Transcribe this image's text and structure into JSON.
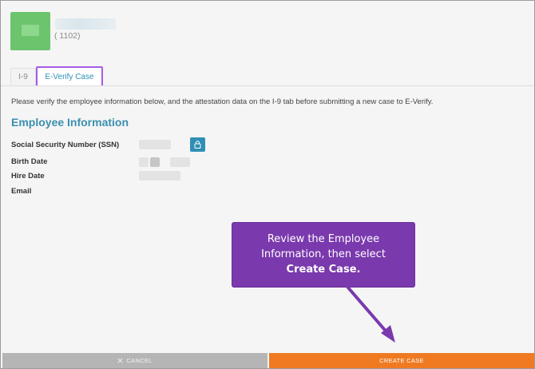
{
  "header": {
    "employee_id": "( 1102)"
  },
  "tabs": [
    {
      "label": "I-9",
      "active": false
    },
    {
      "label": "E-Verify Case",
      "active": true
    }
  ],
  "main": {
    "instructions": "Please verify the employee information below, and the attestation data on the I-9 tab before submitting a new case to E-Verify.",
    "section_title": "Employee Information",
    "fields": [
      {
        "label": "Social Security Number (SSN)"
      },
      {
        "label": "Birth Date"
      },
      {
        "label": "Hire Date"
      },
      {
        "label": "Email"
      }
    ]
  },
  "callout": {
    "line1": "Review the Employee",
    "line2": "Information, then select",
    "line3": "Create Case."
  },
  "footer": {
    "cancel_icon": "close-icon",
    "cancel_label": "CANCEL",
    "create_label": "CREATE CASE"
  },
  "colors": {
    "accent": "#2f8fb5",
    "callout": "#7a39ad",
    "tab_highlight": "#a45ce6",
    "create_button": "#ef7a22",
    "cancel_button": "#b5b5b5",
    "avatar": "#6cc46c"
  }
}
